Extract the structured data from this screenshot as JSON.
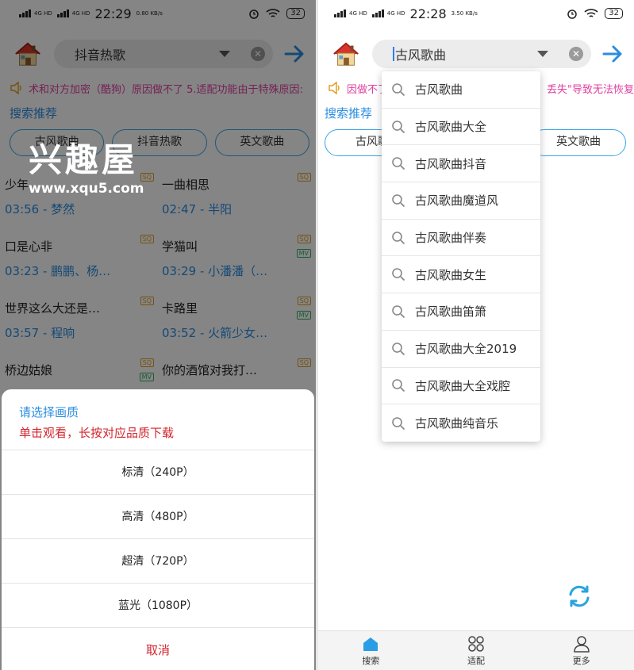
{
  "left": {
    "status": {
      "net": "4G HD",
      "time": "22:29",
      "speed": "0.80 KB/s",
      "battery": "32"
    },
    "search_value": "抖音热歌",
    "marquee": "术和对方加密（酷狗）原因做不了 5.适配功能由于特殊原因:",
    "rec_title": "搜索推荐",
    "pills": [
      "古风歌曲",
      "抖音热歌",
      "英文歌曲"
    ],
    "songs": [
      {
        "name": "少年",
        "meta": "03:56 - 梦然",
        "sq": true,
        "mv": false
      },
      {
        "name": "一曲相思",
        "meta": "02:47 - 半阳",
        "sq": true,
        "mv": false
      },
      {
        "name": "口是心非",
        "meta": "03:23 - 鹏鹏、杨…",
        "sq": true,
        "mv": false
      },
      {
        "name": "学猫叫",
        "meta": "03:29 - 小潘潘（…",
        "sq": true,
        "mv": true
      },
      {
        "name": "世界这么大还是…",
        "meta": "03:57 - 程响",
        "sq": true,
        "mv": false
      },
      {
        "name": "卡路里",
        "meta": "03:52 - 火箭少女…",
        "sq": true,
        "mv": true
      },
      {
        "name": "桥边姑娘",
        "meta": "",
        "sq": true,
        "mv": true
      },
      {
        "name": "你的酒馆对我打…",
        "meta": "",
        "sq": true,
        "mv": false
      }
    ],
    "watermark": {
      "title": "兴趣屋",
      "url": "www.xqu5.com"
    },
    "sheet": {
      "title": "请选择画质",
      "subtitle": "单击观看，长按对应品质下载",
      "options": [
        "标清（240P）",
        "高清（480P）",
        "超清（720P）",
        "蓝光（1080P）"
      ],
      "cancel": "取消"
    }
  },
  "right": {
    "status": {
      "net": "4G HD",
      "time": "22:28",
      "speed": "3.50 KB/s",
      "battery": "32"
    },
    "search_value": "古风歌曲",
    "marquee_left": "因做不了",
    "marquee_right": "丢失\"导致无法恢复",
    "rec_title": "搜索推荐",
    "pills": [
      "古风歌",
      "英文歌曲"
    ],
    "suggestions": [
      "古风歌曲",
      "古风歌曲大全",
      "古风歌曲抖音",
      "古风歌曲魔道风",
      "古风歌曲伴奏",
      "古风歌曲女生",
      "古风歌曲笛箫",
      "古风歌曲大全2019",
      "古风歌曲大全戏腔",
      "古风歌曲纯音乐"
    ],
    "nav": [
      "搜索",
      "适配",
      "更多"
    ]
  },
  "colors": {
    "accent": "#2a8de0",
    "pink": "#e040a0",
    "red": "#d2252c"
  }
}
